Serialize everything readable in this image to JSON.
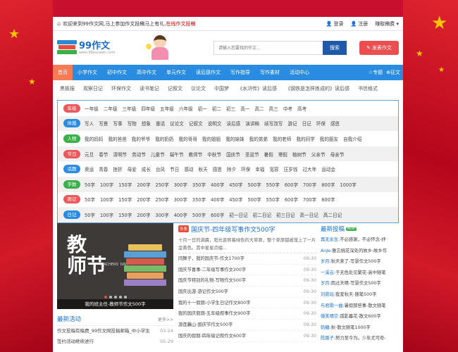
{
  "topbar": {
    "welcome_prefix": "欢迎来到99作文网,马上参加作文投稿马上有礼,",
    "welcome_link": "在线作文投稿",
    "login": "登录",
    "register": "注册",
    "earn": "赚取稿费"
  },
  "header": {
    "logo_name": "99作文",
    "logo_url": "www.99zuowen.com",
    "search_placeholder": "请输入您要找的作文...",
    "search_button": "搜索",
    "publish_button": "发表作文"
  },
  "nav": {
    "items": [
      "首页",
      "小学作文",
      "初中作文",
      "高中作文",
      "单元作文",
      "读后感作文",
      "写作指导",
      "写作素材",
      "活动中心"
    ],
    "right": [
      "专题",
      "征文"
    ]
  },
  "subnav": [
    "黑板报",
    "观察日记",
    "环保作文",
    "读书笔记",
    "记叙文",
    "议论文",
    "中国梦",
    "《水浒传》读后感",
    "《钢铁是怎样炼成的》读后感",
    "书信格式"
  ],
  "categories": [
    {
      "tag": "年级",
      "color": "#ea5a5a",
      "items": [
        "一年级",
        "二年级",
        "三年级",
        "四年级",
        "五年级",
        "六年级",
        "初一",
        "初二",
        "初三",
        "高一",
        "高二",
        "高三",
        "中考",
        "高考"
      ]
    },
    {
      "tag": "体裁",
      "color": "#2a8ce0",
      "items": [
        "写人",
        "写景",
        "写事",
        "写物",
        "想象",
        "童话",
        "议论文",
        "记叙文",
        "说明文",
        "读后感",
        "演讲稿",
        "续写改写",
        "游记",
        "日记",
        "环保",
        "感恩"
      ]
    },
    {
      "tag": "人物",
      "color": "#3cae4a",
      "items": [
        "我的妈妈",
        "我的爸爸",
        "我的爷爷",
        "我的奶奶",
        "我的哥哥",
        "我的姐姐",
        "我的妹妹",
        "我的弟弟",
        "我的老师",
        "我的同学",
        "我的朋友",
        "自我介绍"
      ]
    },
    {
      "tag": "节日",
      "color": "#ea5a5a",
      "items": [
        "元旦",
        "春节",
        "清明节",
        "劳动节",
        "儿童节",
        "端午节",
        "教师节",
        "中秋节",
        "国庆节",
        "圣诞节",
        "暑假",
        "寒假",
        "植树节",
        "父亲节",
        "母亲节"
      ]
    },
    {
      "tag": "话题",
      "color": "#2a8ce0",
      "items": [
        "奥运",
        "青春",
        "挫折",
        "母爱",
        "成长",
        "台风",
        "节日",
        "感动",
        "秋天",
        "感恩",
        "除夕",
        "环保",
        "幸福",
        "宽容",
        "压岁钱",
        "过大年",
        "运动会"
      ]
    },
    {
      "tag": "字数",
      "color": "#3cae4a",
      "items": [
        "50字",
        "100字",
        "150字",
        "200字",
        "250字",
        "300字",
        "350字",
        "400字",
        "450字",
        "500字",
        "550字",
        "600字",
        "700字",
        "800字",
        "1000字"
      ]
    },
    {
      "tag": "周记",
      "color": "#ea5a5a",
      "items": [
        "50字",
        "100字",
        "150字",
        "200字",
        "250字",
        "300字",
        "350字",
        "400字",
        "450字",
        "500字",
        "550字",
        "600字",
        "700字",
        "800字"
      ]
    },
    {
      "tag": "日记",
      "color": "#2a8ce0",
      "items": [
        "50字",
        "100字",
        "150字",
        "200字",
        "300字",
        "400字",
        "500字",
        "600字",
        "初一日记",
        "初二日记",
        "初三日记",
        "高一日记",
        "高二日记"
      ]
    }
  ],
  "slide": {
    "title_line1": "教",
    "title_line2": "师节",
    "subtitle": "TEACHERS' DAY",
    "caption": "我的班主任-教师节作文500字"
  },
  "activity": {
    "title": "最新活动",
    "more": "更多>>",
    "rows": [
      {
        "text": "作文投稿有稿费_99作文网投稿邮箱_中小学生",
        "date": "03-24"
      },
      {
        "text": "签约活动继续进行",
        "date": "05-29"
      }
    ]
  },
  "headline": {
    "badge": "头条",
    "title": "国庆节-四年级写事作文500字",
    "summary": "十月一日的满晨，阳光普照着绿色的大草原，整个草原都被笼上了一片金黄色。其中星星点缀..."
  },
  "articles": [
    {
      "title": "同舞子，我的国庆节-作文1700字",
      "date": "09-30"
    },
    {
      "title": "国庆节喜事-二年级写事作文200字",
      "date": "09-30"
    },
    {
      "title": "国庆节特别的礼物-写物作文500字",
      "date": "09-30"
    },
    {
      "title": "国庆出游-游记作文500字",
      "date": "09-30"
    },
    {
      "title": "我的十一假期-小学生日记作文800字",
      "date": "09-30"
    },
    {
      "title": "我的国庆假期-五年级叙事作文900字",
      "date": "09-30"
    },
    {
      "title": "游莲藕山-国庆节作文500字",
      "date": "09-30"
    },
    {
      "title": "国庆的假期-四年级记叙作文600字",
      "date": "09-30"
    }
  ],
  "latest": {
    "title": "最新投稿",
    "badge": "NEW",
    "rows": [
      {
        "author": "再无余生:",
        "text": "不必感谢，不必怀念-抒"
      },
      {
        "author": "AnJe:",
        "text": "雅忘桃花深处的故乡-故乡作"
      },
      {
        "author": "岁月:",
        "text": "秋天来了-写景作文500字"
      },
      {
        "author": "一溪云:",
        "text": "于无色处见繁花-高中随笔"
      },
      {
        "author": "岁月:",
        "text": "雨过天晴-写景作文500字"
      },
      {
        "author": "刘菀玩:",
        "text": "我爱秋天-随笔500字"
      },
      {
        "author": "与君歌一曲:",
        "text": "暑假那些事-散文随笔"
      },
      {
        "author": "微笑晴空:",
        "text": "孤影暮花-散文600字"
      },
      {
        "author": "奶糖:",
        "text": "秋-散文随笔1000字"
      },
      {
        "author": "陈路子:",
        "text": "努力至今为。少年尤可奇-"
      }
    ]
  }
}
